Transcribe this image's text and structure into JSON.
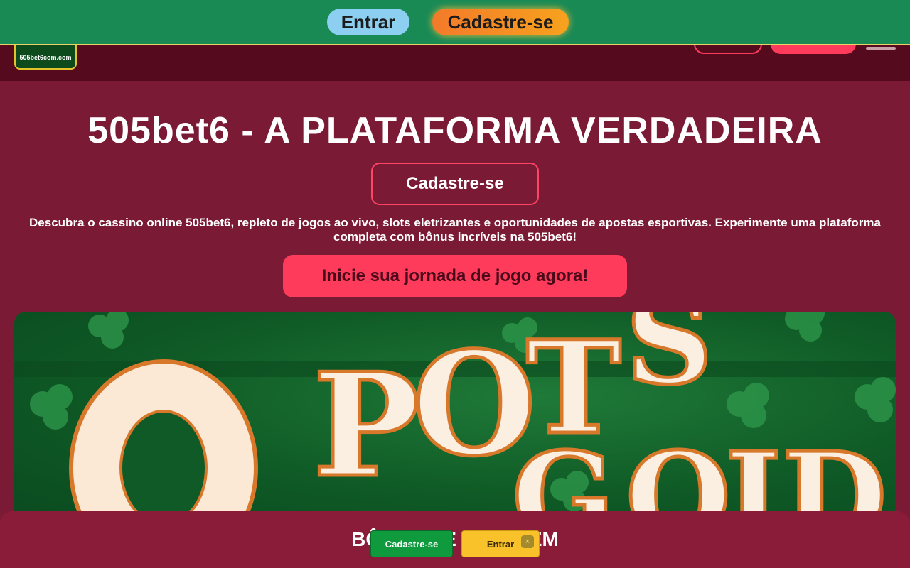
{
  "topbar": {
    "login_label": "Entrar",
    "register_label": "Cadastre-se"
  },
  "header": {
    "logo_text": "505bet6com.com"
  },
  "hero": {
    "title": "505bet6 - A PLATAFORMA VERDADEIRA",
    "register_label": "Cadastre-se",
    "description": "Descubra o cassino online 505bet6, repleto de jogos ao vivo, slots eletrizantes e oportunidades de apostas esportivas. Experimente uma plataforma completa com bônus incríveis na 505bet6!",
    "cta_label": "Inicie sua jornada de jogo agora!"
  },
  "banner": {
    "game_text": "POTS O GOLD"
  },
  "bonus_bar": {
    "text": "BÔNUS DE ... + 75 EM"
  },
  "floating": {
    "register_label": "Cadastre-se",
    "login_label": "Entrar",
    "close_icon": "×"
  },
  "colors": {
    "topbar_green": "#1a8a55",
    "page_bg": "#7a1a34",
    "accent_pink": "#ff3b5c",
    "header_bg": "#560a1e"
  }
}
